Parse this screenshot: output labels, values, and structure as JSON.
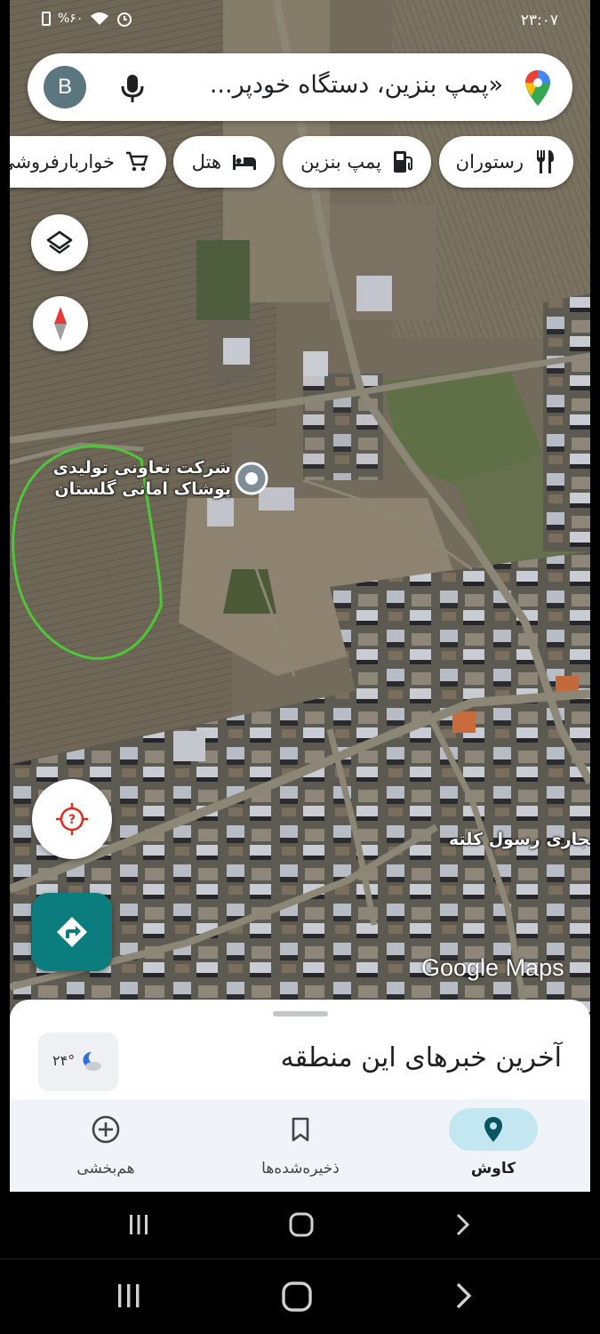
{
  "status": {
    "time": "۲۳:۰۷",
    "battery": "%۶۰"
  },
  "search": {
    "avatar_letter": "B",
    "text": "«پمپ بنزین، دستگاه خودپر..."
  },
  "chips": [
    {
      "label": "رستوران",
      "icon": "restaurant-icon"
    },
    {
      "label": "پمپ بنزین",
      "icon": "gas-station-icon"
    },
    {
      "label": "هتل",
      "icon": "hotel-icon"
    },
    {
      "label": "خواربارفروشی",
      "icon": "shopping-cart-icon"
    }
  ],
  "map": {
    "place_label": "شرکت تعاونی تولیدی\nپوشاک امانی گلستان",
    "place_label_line1": "شرکت تعاونی تولیدی",
    "place_label_line2": "پوشاک امانی گلستان",
    "street_label": "نجاری رسول کلته",
    "watermark": "Google Maps",
    "annotation_color": "#4fc63a"
  },
  "sheet": {
    "title": "آخرین خبرهای این منطقه",
    "temperature": "۲۴°"
  },
  "tabs": [
    {
      "label": "کاوش",
      "icon": "location-pin-icon",
      "active": true
    },
    {
      "label": "ذخیره‌شده‌ها",
      "icon": "bookmark-icon",
      "active": false
    },
    {
      "label": "هم‌بخشی",
      "icon": "add-circle-icon",
      "active": false
    }
  ],
  "colors": {
    "accent": "#0b7d7e",
    "active_tab_bg": "#c2e7f0",
    "compass_red": "#e53935"
  }
}
